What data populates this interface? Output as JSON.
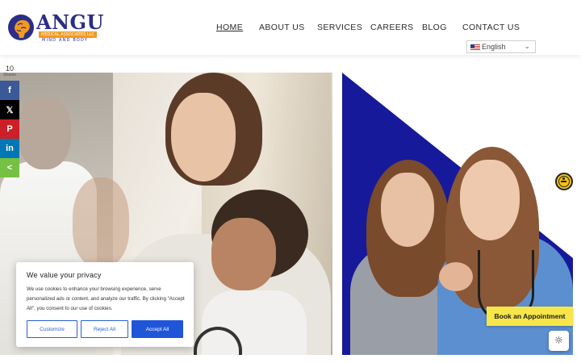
{
  "brand": {
    "name": "ANGU",
    "subtitle": "MEDICAL ASSOCIATES LLC",
    "tagline": "MIND AND BODY"
  },
  "nav": {
    "items": [
      {
        "label": "HOME",
        "active": true
      },
      {
        "label": "ABOUT US",
        "active": false
      },
      {
        "label": "SERVICES",
        "active": false
      },
      {
        "label": "CAREERS",
        "active": false
      },
      {
        "label": "BLOG",
        "active": false
      },
      {
        "label": "CONTACT US",
        "active": false
      }
    ]
  },
  "language": {
    "selected": "English",
    "flag_icon": "us-flag-icon"
  },
  "share": {
    "count": "10",
    "label": "Shares",
    "buttons": [
      {
        "icon": "facebook-icon",
        "glyph": "f",
        "color": "#3b5998"
      },
      {
        "icon": "x-twitter-icon",
        "glyph": "𝕏",
        "color": "#000000"
      },
      {
        "icon": "pinterest-icon",
        "glyph": "P",
        "color": "#cb2027"
      },
      {
        "icon": "linkedin-icon",
        "glyph": "in",
        "color": "#0077b5"
      },
      {
        "icon": "share-icon",
        "glyph": "<",
        "color": "#76c043"
      }
    ]
  },
  "cookie": {
    "title": "We value your privacy",
    "text": "We use cookies to enhance your browsing experience, serve personalized ads or content, and analyze our traffic. By clicking \"Accept All\", you consent to our use of cookies.",
    "customize": "Customize",
    "reject": "Reject All",
    "accept": "Accept All"
  },
  "cta": {
    "book": "Book an Appointment"
  },
  "colors": {
    "brand_blue": "#2b2e86",
    "brand_orange": "#f39a1d",
    "triangle_blue": "#16199a",
    "accept_blue": "#1f56d8",
    "cta_yellow": "#f7e64a"
  }
}
